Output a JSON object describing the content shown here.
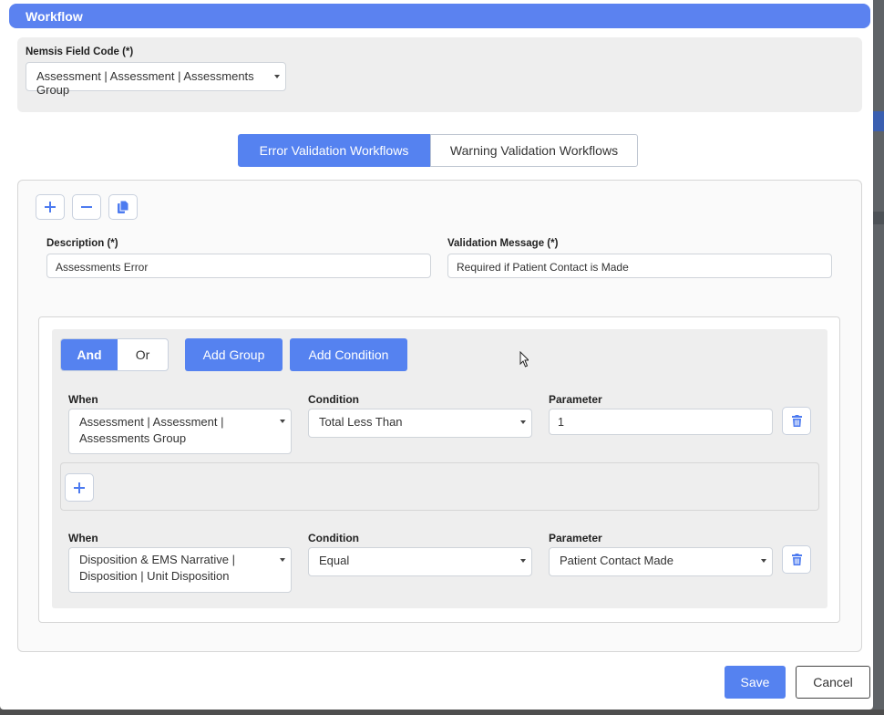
{
  "header": {
    "title": "Workflow"
  },
  "nemsis": {
    "label": "Nemsis Field Code (*)",
    "value": "Assessment | Assessment | Assessments Group"
  },
  "tabs": [
    {
      "label": "Error Validation Workflows",
      "active": true
    },
    {
      "label": "Warning Validation Workflows",
      "active": false
    }
  ],
  "toolbar": {
    "add_icon": "plus-icon",
    "remove_icon": "minus-icon",
    "copy_icon": "copy-icon"
  },
  "description": {
    "label": "Description (*)",
    "value": "Assessments Error"
  },
  "validation_message": {
    "label": "Validation Message (*)",
    "value": "Required if Patient Contact is Made"
  },
  "group": {
    "and_label": "And",
    "or_label": "Or",
    "add_group_label": "Add Group",
    "add_condition_label": "Add Condition",
    "conditions": [
      {
        "when_label": "When",
        "when_line1": "Assessment | Assessment |",
        "when_line2": "Assessments Group",
        "condition_label": "Condition",
        "condition_value": "Total Less Than",
        "parameter_label": "Parameter",
        "parameter_value": "1"
      },
      {
        "when_label": "When",
        "when_line1": "Disposition & EMS Narrative |",
        "when_line2": "Disposition | Unit Disposition",
        "condition_label": "Condition",
        "condition_value": "Equal",
        "parameter_label": "Parameter",
        "parameter_value": "Patient Contact Made"
      }
    ]
  },
  "footer": {
    "save_label": "Save",
    "cancel_label": "Cancel"
  },
  "colors": {
    "accent": "#5582f0",
    "panel": "#eeeeee"
  }
}
